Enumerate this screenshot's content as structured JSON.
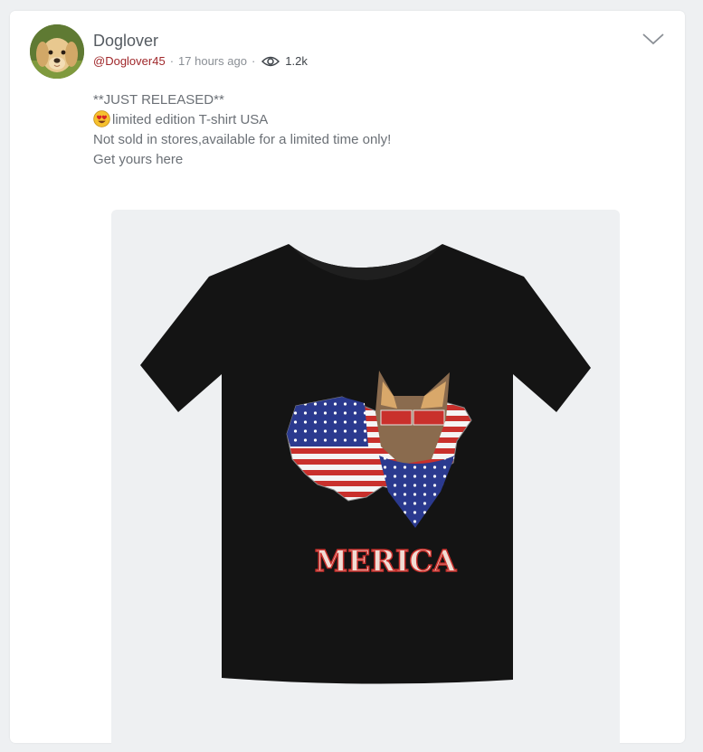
{
  "post": {
    "author_name": "Doglover",
    "author_handle": "@Doglover45",
    "time_ago": "17 hours ago",
    "views": "1.2k",
    "lines": [
      "**JUST RELEASED**",
      "limited edition T-shirt USA",
      "Not sold in stores,available for a limited time only!",
      "Get yours here"
    ],
    "emoji_icon": "heart-eyes-face-icon"
  },
  "product": {
    "shirt_print_text": "MERICA",
    "shirt_color": "#141414",
    "print_red": "#c9302c",
    "print_blue": "#2b3a8f"
  },
  "colors": {
    "handle": "#a0282b",
    "text": "#6b7076",
    "background": "#eef0f2"
  }
}
